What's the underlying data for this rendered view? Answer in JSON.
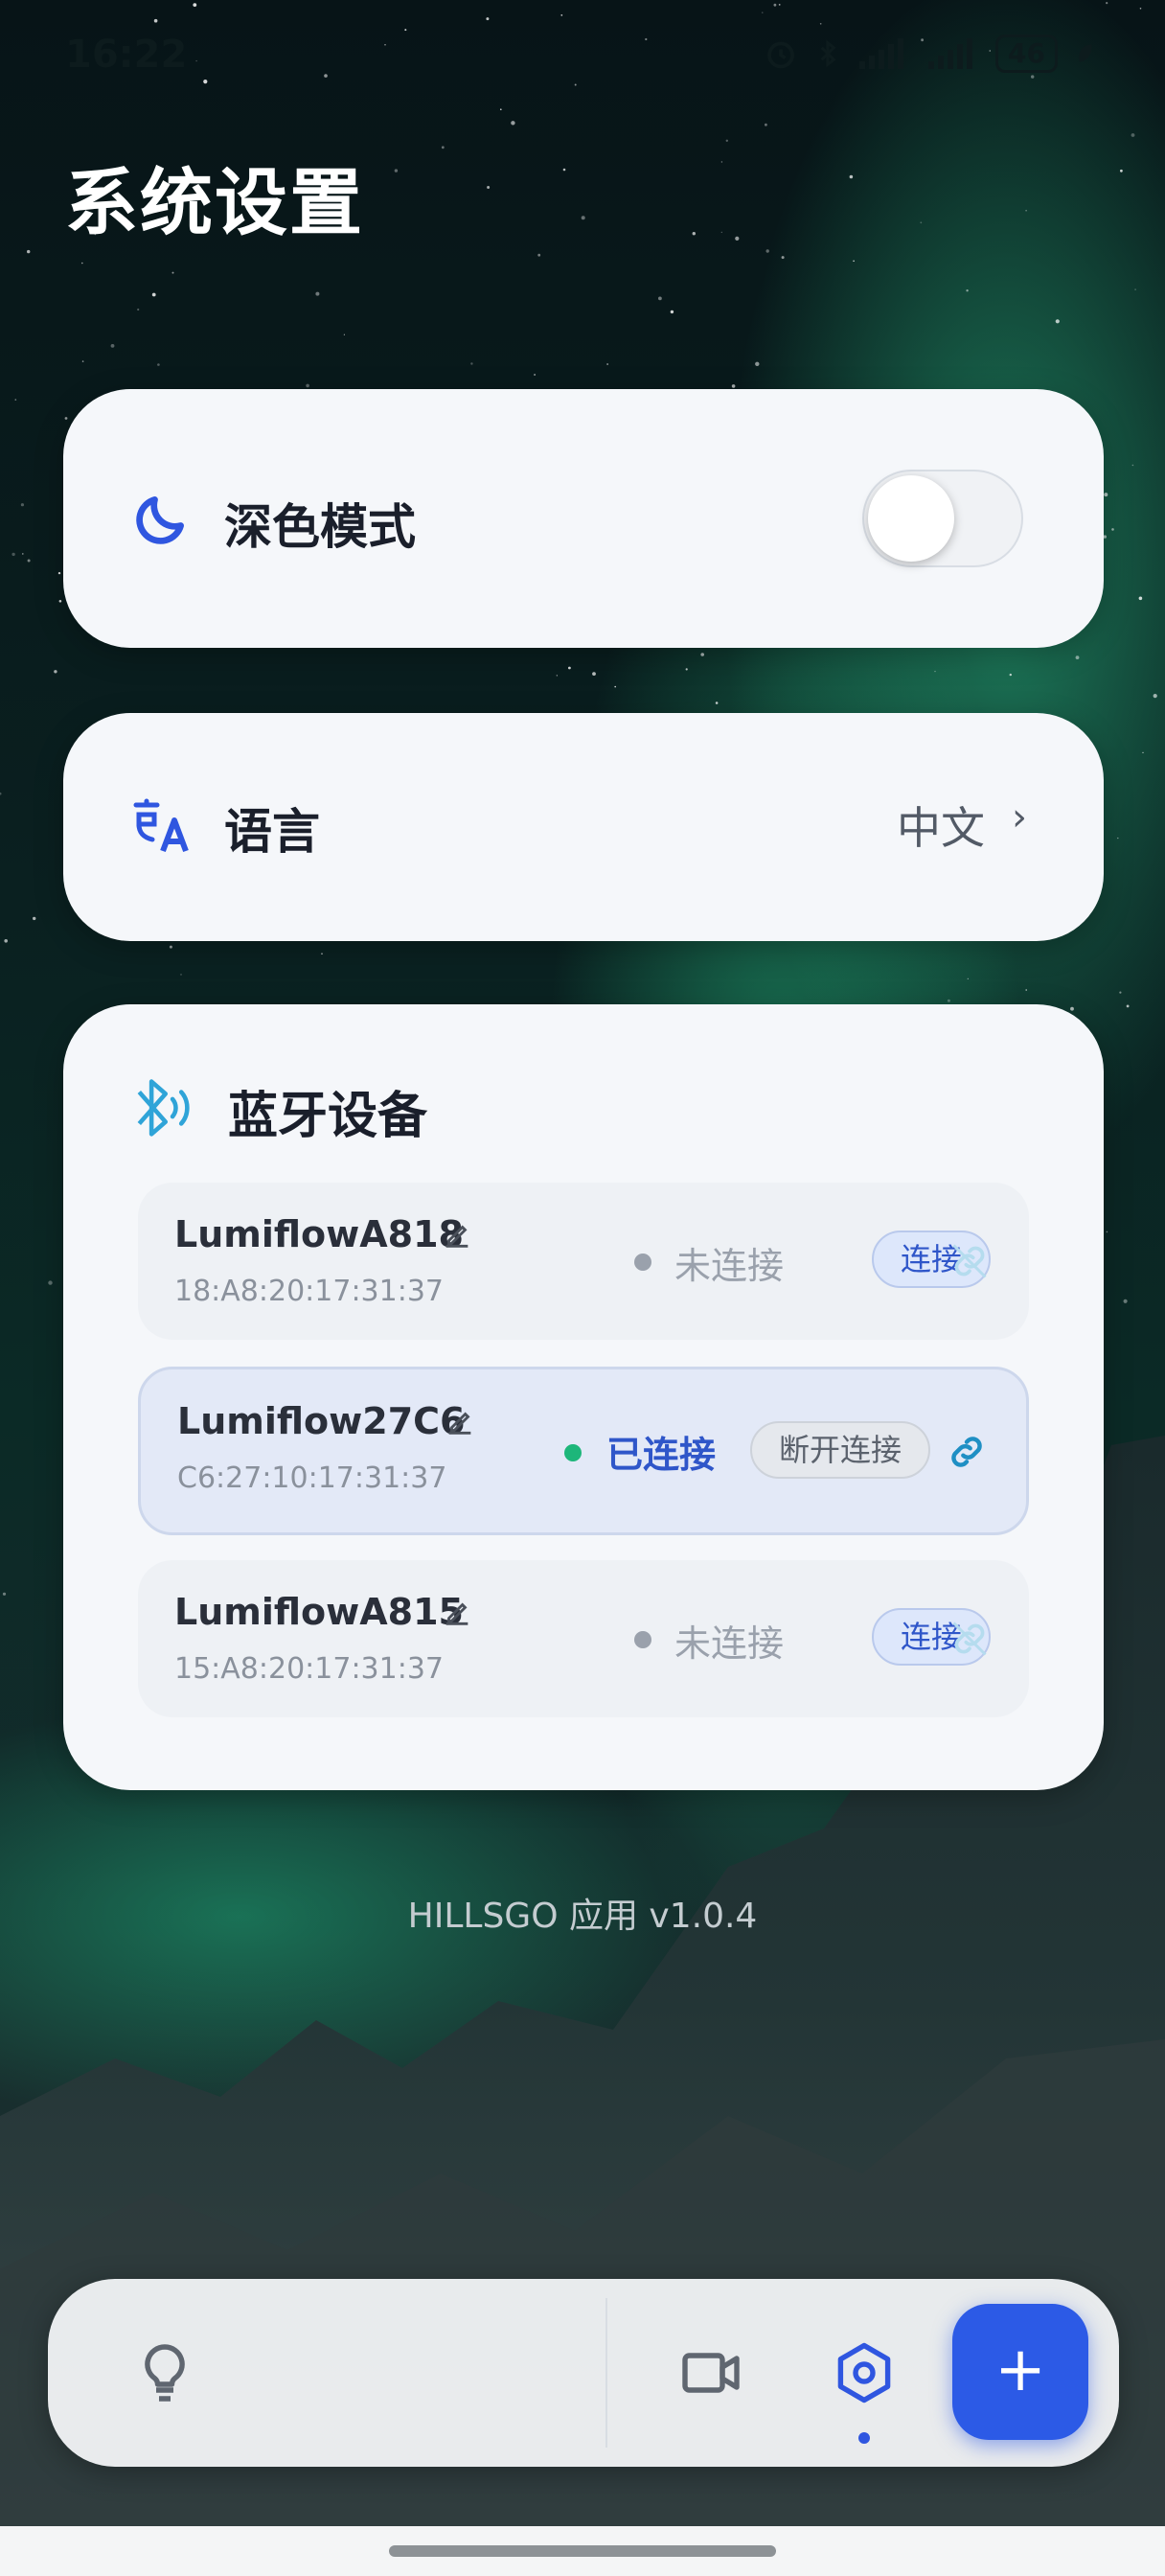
{
  "status_bar": {
    "time": "16:22",
    "battery": "46"
  },
  "page": {
    "title": "系统设置"
  },
  "dark_mode": {
    "label": "深色模式",
    "enabled": false
  },
  "language": {
    "label": "语言",
    "value": "中文"
  },
  "bluetooth": {
    "title": "蓝牙设备",
    "devices": [
      {
        "name": "LumiflowA818",
        "mac": "18:A8:20:17:31:37",
        "status": "未连接",
        "action": "连接",
        "connected": false
      },
      {
        "name": "Lumiflow27C6",
        "mac": "C6:27:10:17:31:37",
        "status": "已连接",
        "action": "断开连接",
        "connected": true
      },
      {
        "name": "LumiflowA815",
        "mac": "15:A8:20:17:31:37",
        "status": "未连接",
        "action": "连接",
        "connected": false
      }
    ]
  },
  "footer": {
    "version": "HILLSGO 应用 v1.0.4"
  },
  "bottom_nav": {
    "items": [
      {
        "icon": "lightbulb-icon"
      },
      {
        "icon": "video-camera-icon"
      },
      {
        "icon": "hexagon-settings-icon",
        "active": true
      }
    ],
    "fab_icon": "plus-icon",
    "fab_label": "+"
  },
  "colors": {
    "accent": "#2c5ae6",
    "connected_green": "#1db67a",
    "disconnected_gray": "#9aa1ac",
    "card_bg": "#f5f7fa"
  }
}
